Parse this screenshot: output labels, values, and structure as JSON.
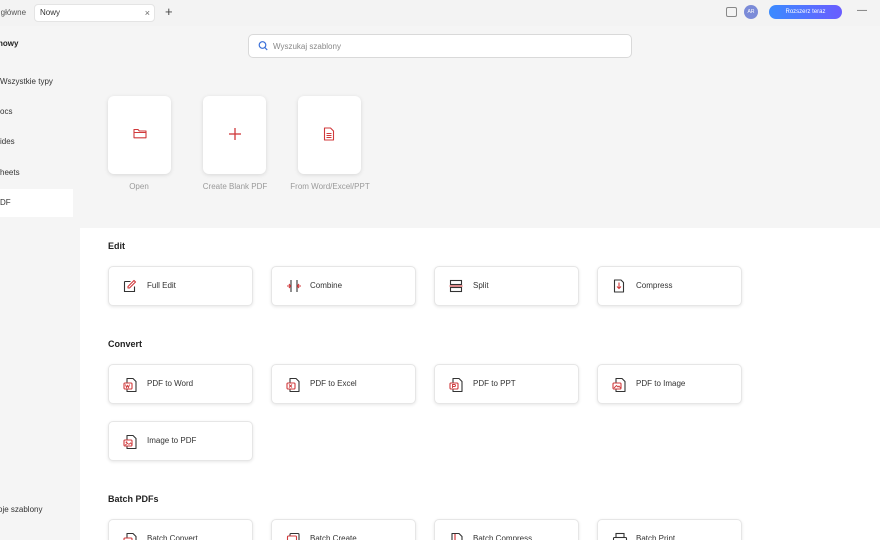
{
  "titlebar": {
    "home_tab": "a główne",
    "active_tab": "Nowy",
    "close_glyph": "×",
    "new_tab_glyph": "+",
    "avatar_text": "AR",
    "upgrade_label": "Rozszerz teraz",
    "minimize_glyph": "—"
  },
  "search": {
    "placeholder": "Wyszukaj szablony"
  },
  "sidebar": {
    "title": "nowy",
    "items": [
      {
        "label": "Wszystkie typy"
      },
      {
        "label": "ocs"
      },
      {
        "label": "ides"
      },
      {
        "label": "heets"
      },
      {
        "label": "DF"
      }
    ],
    "active_index": 4,
    "bottom_label": "oje szablony"
  },
  "quick_actions": [
    {
      "label": "Open",
      "icon": "folder-icon"
    },
    {
      "label": "Create Blank PDF",
      "icon": "plus-icon"
    },
    {
      "label": "From Word/Excel/PPT",
      "icon": "document-icon"
    }
  ],
  "sections": {
    "edit": {
      "title": "Edit",
      "tools": [
        {
          "label": "Full Edit",
          "icon": "edit-icon"
        },
        {
          "label": "Combine",
          "icon": "combine-icon"
        },
        {
          "label": "Split",
          "icon": "split-icon"
        },
        {
          "label": "Compress",
          "icon": "compress-icon"
        }
      ]
    },
    "convert": {
      "title": "Convert",
      "tools": [
        {
          "label": "PDF to Word",
          "icon": "pdf-to-word-icon"
        },
        {
          "label": "PDF to Excel",
          "icon": "pdf-to-excel-icon"
        },
        {
          "label": "PDF to PPT",
          "icon": "pdf-to-ppt-icon"
        },
        {
          "label": "PDF to Image",
          "icon": "pdf-to-image-icon"
        },
        {
          "label": "Image to PDF",
          "icon": "image-to-pdf-icon"
        }
      ]
    },
    "batch": {
      "title": "Batch PDFs",
      "tools": [
        {
          "label": "Batch Convert",
          "icon": "batch-convert-icon"
        },
        {
          "label": "Batch Create",
          "icon": "batch-create-icon"
        },
        {
          "label": "Batch Compress",
          "icon": "batch-compress-icon"
        },
        {
          "label": "Batch Print",
          "icon": "batch-print-icon"
        }
      ]
    }
  },
  "colors": {
    "accent": "#d0393b",
    "upgrade_gradient_start": "#3b8bff",
    "upgrade_gradient_end": "#6a5cff"
  }
}
